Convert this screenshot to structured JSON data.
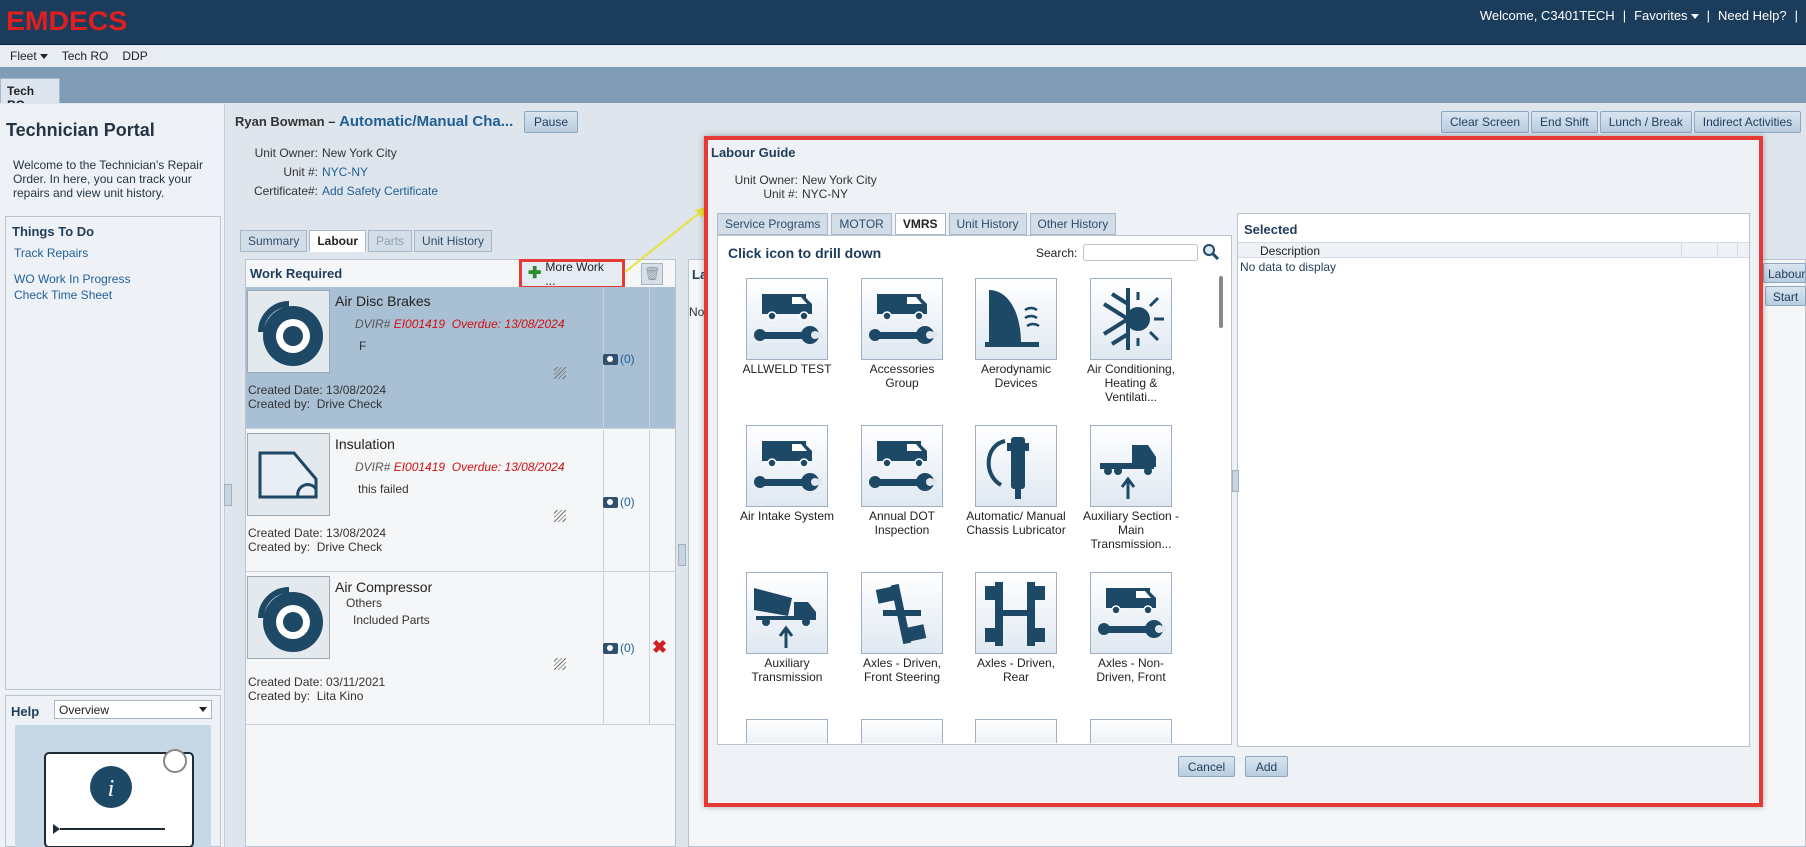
{
  "header": {
    "logo": "EMDECS",
    "welcome": "Welcome, C3401TECH",
    "favorites": "Favorites",
    "need_help": "Need Help?"
  },
  "menubar": {
    "items": [
      "Fleet",
      "Tech RO",
      "DDP"
    ]
  },
  "tab_main": "Tech RO",
  "portal": {
    "title": "Technician Portal",
    "welcome": "Welcome to the Technician's Repair Order. In here, you can track your repairs and view unit history.",
    "todo_title": "Things To Do",
    "todo_items": [
      "Track Repairs",
      "WO Work In Progress",
      "Check Time Sheet"
    ],
    "help_title": "Help",
    "help_select": "Overview"
  },
  "work_order": {
    "tech_name": "Ryan Bowman",
    "separator": "–",
    "title": "Automatic/Manual Cha...",
    "pause": "Pause",
    "unit_owner_label": "Unit Owner:",
    "unit_owner": "New York City",
    "unit_label": "Unit #:",
    "unit": "NYC-NY",
    "cert_label": "Certificate#:",
    "cert_link": "Add Safety Certificate"
  },
  "center_tabs": [
    "Summary",
    "Labour",
    "Parts",
    "Unit History"
  ],
  "work_required": {
    "title": "Work Required",
    "more_work": "More Work ...",
    "rows": [
      {
        "name": "Air Disc Brakes",
        "dvir_label": "DVIR#",
        "dvir": "EI001419",
        "overdue": "Overdue: 13/08/2024",
        "note": "F",
        "created_date": "Created Date:  13/08/2024",
        "created_by_label": "Created by:",
        "created_by": "Drive Check",
        "photos": "(0)"
      },
      {
        "name": "Insulation",
        "dvir_label": "DVIR#",
        "dvir": "EI001419",
        "overdue": "Overdue: 13/08/2024",
        "note": "this failed",
        "created_date": "Created Date:  13/08/2024",
        "created_by_label": "Created by:",
        "created_by": "Drive Check",
        "photos": "(0)"
      },
      {
        "name": "Air Compressor",
        "sub": "Others",
        "link": "Included Parts",
        "created_date": "Created Date:  03/11/2021",
        "created_by_label": "Created by:",
        "created_by": "Lita Kino",
        "photos": "(0)"
      }
    ]
  },
  "right_panel": {
    "buttons": [
      "Clear Screen",
      "End Shift",
      "Lunch / Break",
      "Indirect Activities"
    ],
    "labour_tab": "Labour",
    "start": "Start",
    "col_header": "La",
    "no_data": "No"
  },
  "modal": {
    "title": "Labour Guide",
    "unit_owner_label": "Unit Owner:",
    "unit_owner": "New York City",
    "unit_label": "Unit #:",
    "unit": "NYC-NY",
    "tabs": [
      "Service Programs",
      "MOTOR",
      "VMRS",
      "Unit History",
      "Other History"
    ],
    "drill": "Click icon to drill down",
    "search_label": "Search:",
    "search_value": "",
    "tiles": [
      {
        "label": "ALLWELD TEST",
        "icon": "truck-wrench-icon"
      },
      {
        "label": "Accessories Group",
        "icon": "truck-wrench-icon"
      },
      {
        "label": "Aerodynamic Devices",
        "icon": "aero-icon"
      },
      {
        "label": "Air Conditioning, Heating & Ventilati...",
        "icon": "snow-sun-icon"
      },
      {
        "label": "Air Intake System",
        "icon": "truck-wrench-icon"
      },
      {
        "label": "Annual DOT Inspection",
        "icon": "truck-wrench-icon"
      },
      {
        "label": "Automatic/ Manual Chassis Lubricator",
        "icon": "grease-gun-icon"
      },
      {
        "label": "Auxiliary Section - Main Transmission...",
        "icon": "tractor-arrow-icon"
      },
      {
        "label": "Auxiliary Transmission",
        "icon": "dump-truck-icon"
      },
      {
        "label": "Axles - Driven, Front Steering",
        "icon": "axle-steer-icon"
      },
      {
        "label": "Axles - Driven, Rear",
        "icon": "axle-rear-icon"
      },
      {
        "label": "Axles - Non-Driven, Front",
        "icon": "truck-wrench-icon"
      }
    ],
    "selected_title": "Selected",
    "selected_header": "Description",
    "selected_empty": "No data to display",
    "cancel": "Cancel",
    "add": "Add"
  },
  "colors": {
    "header": "#1b3c5b",
    "logo": "#e02020",
    "highlight": "#e53935",
    "link": "#1f5f96",
    "overdue": "#d01010",
    "icon_fill": "#1d4866"
  }
}
